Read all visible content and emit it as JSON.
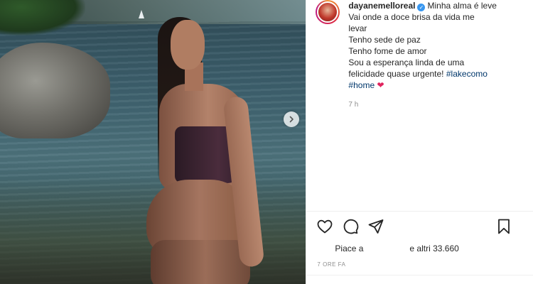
{
  "post": {
    "username": "dayanemelloreal",
    "caption_lines": [
      "Minha alma é leve",
      "Vai onde a doce brisa da vida me",
      "levar",
      "Tenho sede de paz",
      "Tenho fome de amor",
      "Sou a esperança linda de uma",
      "felicidade quase urgente!"
    ],
    "hashtags": [
      "#lakecomo",
      "#home"
    ],
    "caption_time": "7 h",
    "likes_prefix": "Piace a",
    "likes_suffix": "e altri 33.660",
    "posted_ago": "7 ORE FA"
  },
  "icons": {
    "verified": "verified-badge-icon",
    "heart_emoji": "red-heart-emoji",
    "like": "heart-outline-icon",
    "comment": "comment-bubble-icon",
    "share": "paper-plane-icon",
    "save": "bookmark-icon",
    "next": "chevron-right-icon"
  },
  "colors": {
    "verified": "#3897f0",
    "hashtag": "#00376b",
    "heart": "#e0245e",
    "muted": "#8e8e8e"
  }
}
